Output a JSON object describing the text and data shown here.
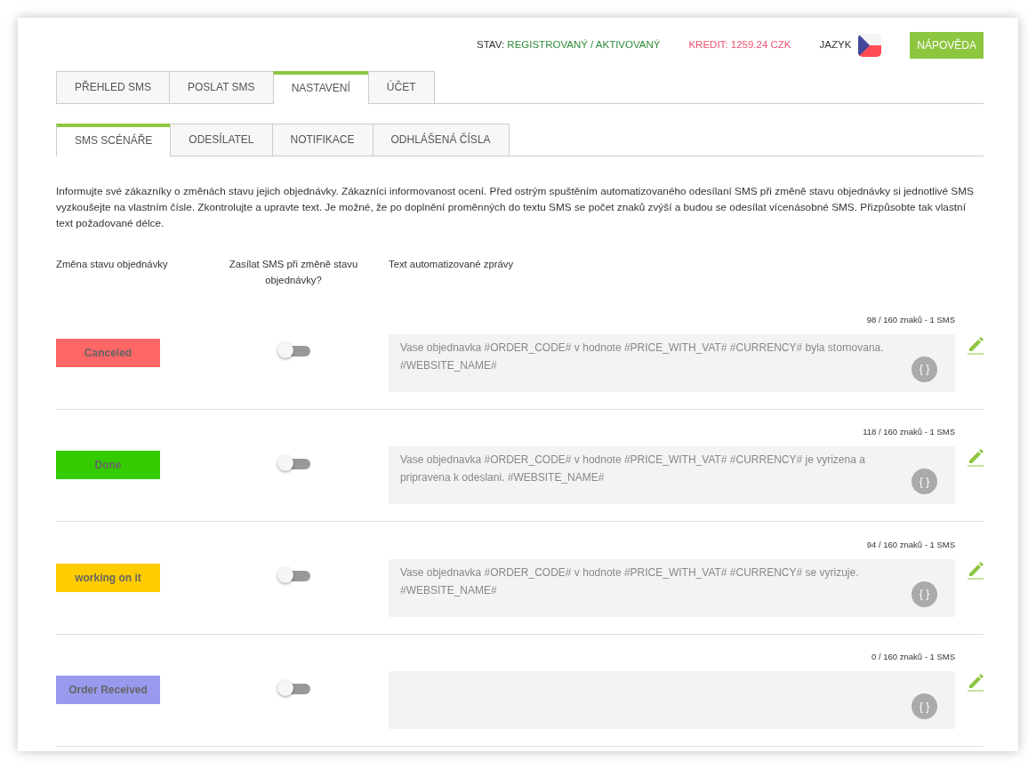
{
  "header": {
    "status_label": "STAV:",
    "status_value": "REGISTROVANÝ / AKTIVOVANÝ",
    "credit": "KREDIT: 1259.24 CZK",
    "language_label": "JAZYK",
    "help_button": "NÁPOVĚDA"
  },
  "tabs": [
    {
      "label": "PŘEHLED SMS",
      "selected": false
    },
    {
      "label": "POSLAT SMS",
      "selected": false
    },
    {
      "label": "NASTAVENÍ",
      "selected": true
    },
    {
      "label": "ÚČET",
      "selected": false
    }
  ],
  "subtabs": [
    {
      "label": "SMS SCÉNÁŘE",
      "selected": true
    },
    {
      "label": "ODESÍLATEL",
      "selected": false
    },
    {
      "label": "NOTIFIKACE",
      "selected": false
    },
    {
      "label": "ODHLÁŠENÁ ČÍSLA",
      "selected": false
    }
  ],
  "intro": "Informujte své zákazníky o změnách stavu jejich objednávky. Zákazníci informovanost ocení. Před ostrým spuštěním automatizovaného odesílaní SMS při změně stavu objednávky si jednotlivé SMS vyzkoušejte na vlastním čísle. Zkontrolujte a upravte text. Je možné, že po doplnění proměnných do textu SMS se počet znaků zvýší a budou se odesílat vícenásobné SMS. Přizpůsobte tak vlastní text požadované délce.",
  "columns": [
    "Změna stavu objednávky",
    "Zasílat SMS při změně stavu objednávky?",
    "Text automatizované zprávy"
  ],
  "scenarios": [
    {
      "status": "Canceled",
      "color": "#ff6666",
      "on": false,
      "counter": "98 / 160 znaků - 1 SMS",
      "message": "Vase objednavka #ORDER_CODE# v hodnote #PRICE_WITH_VAT# #CURRENCY# byla stornovana. #WEBSITE_NAME#",
      "insert_label": "{ }"
    },
    {
      "status": "Done",
      "color": "#33cc00",
      "on": false,
      "counter": "118 / 160 znaků - 1 SMS",
      "message": "Vase objednavka #ORDER_CODE# v hodnote #PRICE_WITH_VAT# #CURRENCY# je vyrizena a pripravena k odeslani. #WEBSITE_NAME#",
      "insert_label": "{ }"
    },
    {
      "status": "working on it",
      "color": "#ffcc00",
      "on": false,
      "counter": "94 / 160 znaků - 1 SMS",
      "message": "Vase objednavka #ORDER_CODE# v hodnote #PRICE_WITH_VAT# #CURRENCY# se vyrizuje. #WEBSITE_NAME#",
      "insert_label": "{ }"
    },
    {
      "status": "Order Received",
      "color": "#9999ee",
      "on": false,
      "counter": "0 / 160 znaků - 1 SMS",
      "insert_label": "{ }"
    }
  ]
}
